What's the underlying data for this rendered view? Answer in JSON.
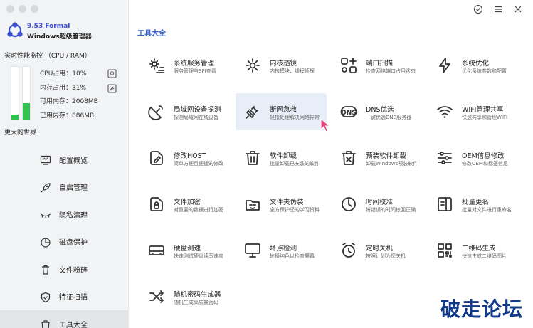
{
  "app": {
    "version": "9.53 Formal",
    "name": "Windows超级管理器"
  },
  "monitor": {
    "title": "实时性能监控 （CPU / RAM）",
    "cpu_usage_fraction": 0.1,
    "mem_usage_fraction": 0.31,
    "cpu_label": "CPU占用：10%",
    "mem_label": "内存占用：31%",
    "avail_label": "可用内存：2008MB",
    "used_label": "已用内存：886MB"
  },
  "sidebar": {
    "section": "更大的世界",
    "items": [
      {
        "label": "配置概览",
        "icon": "monitor-icon"
      },
      {
        "label": "自启管理",
        "icon": "rocket-icon"
      },
      {
        "label": "隐私清理",
        "icon": "eye-closed-icon"
      },
      {
        "label": "磁盘保护",
        "icon": "pie-chart-icon"
      },
      {
        "label": "文件粉碎",
        "icon": "trash-icon"
      },
      {
        "label": "特征扫描",
        "icon": "shield-icon"
      },
      {
        "label": "工具大全",
        "icon": "toolbox-icon"
      }
    ]
  },
  "main": {
    "title": "工具大全",
    "tools": [
      {
        "name": "系统服务管理",
        "desc": "服务管理与SPI查看",
        "icon": "gear-list-icon"
      },
      {
        "name": "内核透镜",
        "desc": "内核模块、线程侦探",
        "icon": "sun-icon"
      },
      {
        "name": "端口扫描",
        "desc": "检查网络端口占用状态",
        "icon": "port-icon"
      },
      {
        "name": "系统优化",
        "desc": "优化系统参数和配置",
        "icon": "lightning-icon"
      },
      {
        "name": "局域网设备探测",
        "desc": "探测局域网在线设备",
        "icon": "satellite-icon"
      },
      {
        "name": "断网急救",
        "desc": "轻松处理解决网络异常",
        "icon": "plug-icon"
      },
      {
        "name": "DNS优选",
        "desc": "一键优选DNS服务器",
        "icon": "dns-icon"
      },
      {
        "name": "WIFI管理共享",
        "desc": "快速共享和管理WIFI",
        "icon": "wifi-icon"
      },
      {
        "name": "修改HOST",
        "desc": "简单方便且便捷的修改",
        "icon": "edit-doc-icon"
      },
      {
        "name": "软件卸载",
        "desc": "批量卸载已安装的软件",
        "icon": "trash-icon"
      },
      {
        "name": "预装软件卸载",
        "desc": "卸载Windows预装软件",
        "icon": "trash-box-icon"
      },
      {
        "name": "OEM信息修改",
        "desc": "修改OEM和标签信息",
        "icon": "sliders-icon"
      },
      {
        "name": "文件加密",
        "desc": "对重要的数据进行加密",
        "icon": "lock-doc-icon"
      },
      {
        "name": "文件夹伪装",
        "desc": "全方保护您的学习资料",
        "icon": "mask-folder-icon"
      },
      {
        "name": "时间校准",
        "desc": "将错误的时间校回正确",
        "icon": "clock-icon"
      },
      {
        "name": "批量更名",
        "desc": "批量对文件进行重命名",
        "icon": "rename-icon"
      },
      {
        "name": "硬盘测速",
        "desc": "快速测试硬盘读写速度",
        "icon": "disk-icon"
      },
      {
        "name": "坏点检测",
        "desc": "轮播纯色以检查屏幕",
        "icon": "display-icon"
      },
      {
        "name": "定时关机",
        "desc": "按照计划为您关机",
        "icon": "alarm-icon"
      },
      {
        "name": "二维码生成",
        "desc": "快速生成二维码图片",
        "icon": "qr-icon"
      },
      {
        "name": "随机密码生成器",
        "desc": "随机生成高质量密码",
        "icon": "shuffle-icon"
      }
    ]
  },
  "watermark": "破走论坛",
  "colors": {
    "accent": "#2f5fc8",
    "bar_fill": "#33c24d",
    "highlight": "#e8eef7",
    "watermark": "#123a8a"
  }
}
